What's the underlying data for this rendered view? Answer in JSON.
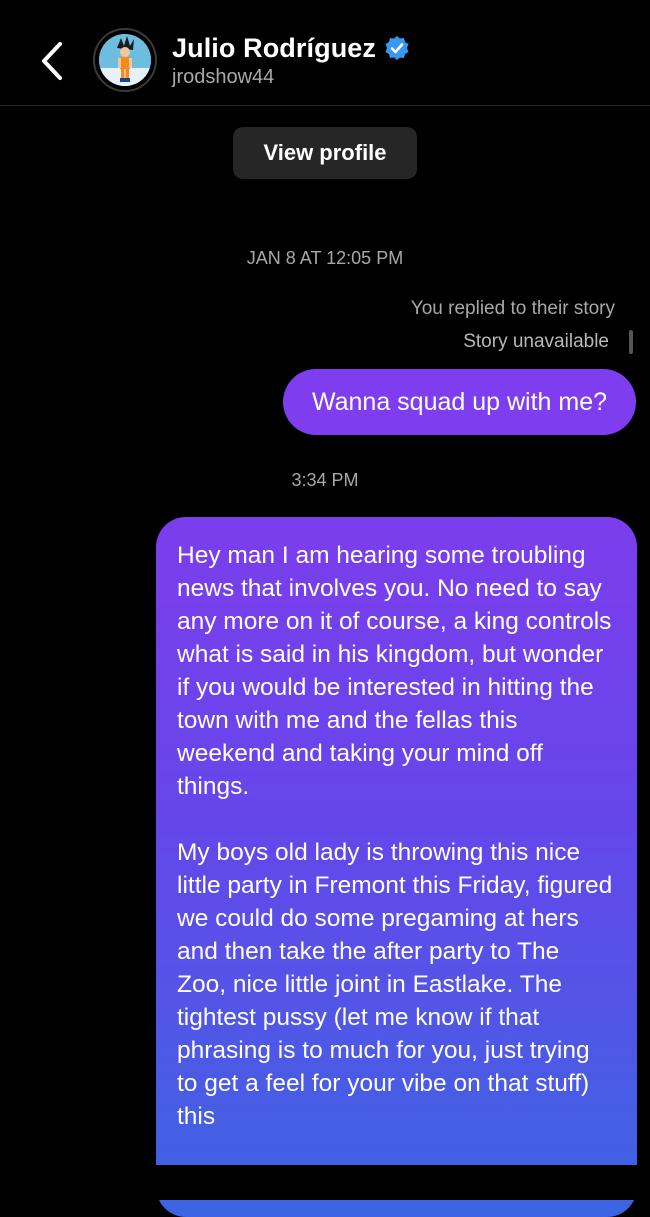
{
  "header": {
    "name": "Julio Rodríguez",
    "username": "jrodshow44",
    "verified": true,
    "back_icon": "chevron-left-icon",
    "verified_icon": "verified-badge-icon",
    "avatar_icon": "avatar-image"
  },
  "view_profile_label": "View profile",
  "thread": {
    "timestamp1": "JAN 8 AT 12:05 PM",
    "story_reply_note": "You replied to their story",
    "story_status": "Story unavailable",
    "message1": "Wanna squad up with me?",
    "timestamp2": "3:34 PM",
    "message2_p1": "Hey man I am hearing some troubling news that involves you. No need to say any more on it of course, a king controls what is said in his kingdom, but wonder if you would be interested in hitting the town with me and the fellas this weekend and taking your mind off things.",
    "message2_p2": "My boys old lady is throwing this nice little party in Fremont this Friday, figured we could do some pregaming at hers and then take the after party to The Zoo, nice little joint in Eastlake. The tightest pussy (let me know if that phrasing is to much for you, just trying to get a feel for your vibe on that stuff) this"
  },
  "colors": {
    "background": "#000000",
    "bubble_purple": "#7e3ef0",
    "bubble_blue": "#3a64e2",
    "secondary_text": "#a8a8a8",
    "button_bg": "#262626",
    "verified_blue": "#3897f0"
  }
}
